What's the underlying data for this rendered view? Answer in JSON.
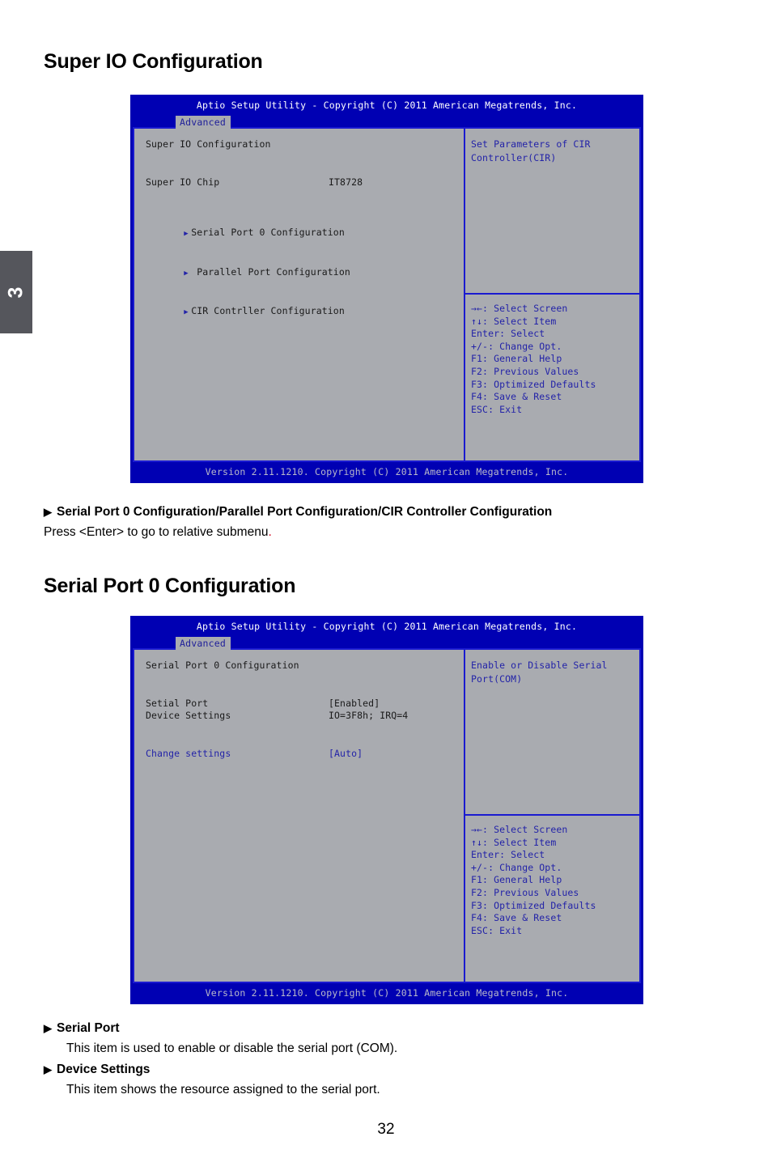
{
  "chapter_tab": {
    "number": "3"
  },
  "page_number": "32",
  "section_1": {
    "heading": "Super IO Configuration",
    "bullet": "Serial Port 0 Configuration/Parallel Port Configuration/CIR Controller Configuration",
    "description_pre": "Press <Enter> to go to relative submenu",
    "description_dot": "."
  },
  "section_2": {
    "heading": "Serial Port 0 Configuration",
    "items": [
      {
        "bullet": "Serial Port",
        "description": "This item is used to enable or disable the serial port (COM)."
      },
      {
        "bullet": "Device Settings",
        "description": "This item shows the resource assigned to the serial port."
      }
    ]
  },
  "bios_common": {
    "title": "Aptio Setup Utility - Copyright (C) 2011 American Megatrends, Inc.",
    "tab": "Advanced",
    "footer": "Version 2.11.1210. Copyright (C) 2011 American Megatrends, Inc.",
    "keys": [
      "→←: Select Screen",
      "↑↓: Select Item",
      "Enter: Select",
      "+/-: Change Opt.",
      "F1: General Help",
      "F2: Previous Values",
      "F3: Optimized Defaults",
      "F4: Save & Reset",
      "ESC: Exit"
    ],
    "colors": {
      "title_bar_blue": "#0000b3",
      "panel_gray": "#a9abb0",
      "border_blue": "#1a1ad0",
      "text_blue": "#2323a8",
      "text_dark": "#1a1a1a",
      "footer_text": "#b9b9c9",
      "chapter_tab_gray": "#55565c",
      "accent_red": "#d0021b"
    }
  },
  "bios_screen_1": {
    "section_label": "Super IO Configuration",
    "chip_label": "Super IO Chip",
    "chip_value": "IT8728",
    "submenus": [
      "Serial Port 0 Configuration",
      " Parallel Port Configuration",
      "CIR Contrller Configuration"
    ],
    "help": [
      "Set Parameters of CIR",
      "Controller(CIR)"
    ]
  },
  "bios_screen_2": {
    "section_label": "Serial Port 0 Configuration",
    "rows": [
      {
        "label": "Setial Port",
        "value": "[Enabled]",
        "blue": false
      },
      {
        "label": "Device Settings",
        "value": "IO=3F8h; IRQ=4",
        "blue": false
      }
    ],
    "change_row": {
      "label": "Change settings",
      "value": "[Auto]"
    },
    "help": [
      "Enable or Disable Serial",
      "Port(COM)"
    ]
  }
}
